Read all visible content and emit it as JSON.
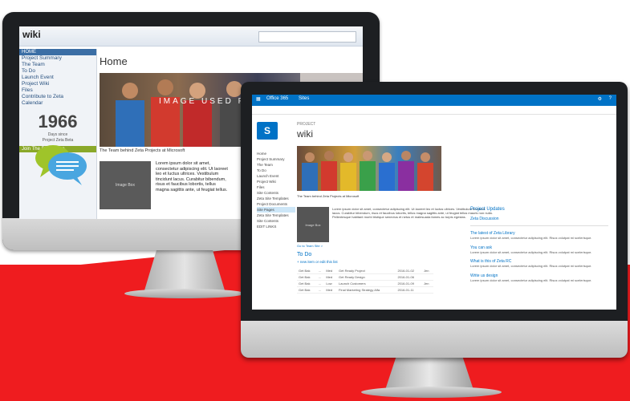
{
  "back_screen": {
    "logo": "wiki",
    "sidebar_header": "HOME",
    "sidebar_items": [
      "Project Summary",
      "The Team",
      "To Do",
      "Launch Event",
      "Project Wiki",
      "Files",
      "Contribute to Zeta",
      "Calendar"
    ],
    "big_number": "1966",
    "big_number_sub1": "Days since",
    "big_number_sub2": "Project Zeta Beta",
    "green_bar": "Join The Discussion",
    "page_title": "Home",
    "hero_overlay": "IMAGE USED FOR W",
    "caption": "The Team behind Zeta Projects at Microsoft",
    "image_placeholder": "Image Box",
    "body_text": "Lorem ipsum dolor sit amet, consectetur adipiscing elit. Ut laoreet leo et luctus ultrices. Vestibulum tincidunt lacus. Curabitur bibendum, risus et faucibus lobortis, tellus magna sagittis ante, ut feugiat tellus."
  },
  "front_screen": {
    "topbar_brand": "Office 365",
    "topbar_app": "Sites",
    "crumb": "PROJECT",
    "title": "wiki",
    "nav_items": [
      "Home",
      "Project Summary",
      "The Team",
      "To Do",
      "Launch Event",
      "Project Wiki",
      "Files",
      "Site Contents",
      "Zeta Site Templates",
      "Project Documents",
      "Site Pages",
      "Zeta Site Templates",
      "Site Contents",
      "EDIT LINKS"
    ],
    "caption": "The Team behind Zeta Projects at Microsoft",
    "image_placeholder": "Image Box",
    "body_text": "Lorem ipsum dolor sit amet, consectetur adipiscing elit. Ut laoreet leo et luctus ultrices. Vestibulum tincidunt lacus. Curabitur bibendum, risus et faucibus lobortis, tellus magna sagittis ante, ut feugiat tellus mauris non nulla. Pellentesque habitant morbi tristique senectus et netus et malesuada fames ac turpis egestas.",
    "link": "Go to Team Site >",
    "todo_heading": "To Do",
    "new_item": "+ new item or edit this list",
    "todo_rows": [
      [
        "Get Bak",
        "...",
        "Med",
        "Get Ready Project",
        "2016-01-02",
        "Jen"
      ],
      [
        "Get Bak",
        "...",
        "Med",
        "Get Ready Design",
        "2016-01-06",
        ""
      ],
      [
        "Get Bak",
        "...",
        "Low",
        "Launch Customers",
        "2016-01-09",
        "Jen"
      ],
      [
        "Get Bak",
        "...",
        "Med",
        "Final Marketing Strategy Alfa",
        "2016-01-11",
        ""
      ]
    ],
    "right_heading": "Project Updates",
    "right_sub": "Zeta Discussion",
    "right_items": [
      {
        "title": "The latest of Zeta Library",
        "text": "Lorem ipsum dolor sit amet, consectetur adipiscing elit. Risus volutpat mi scelerisque."
      },
      {
        "title": "You can ask",
        "text": "Lorem ipsum dolor sit amet, consectetur adipiscing elit. Risus volutpat mi scelerisque."
      },
      {
        "title": "What is this of Zeta RC",
        "text": "Lorem ipsum dolor sit amet, consectetur adipiscing elit. Risus volutpat mi scelerisque."
      },
      {
        "title": "Write us design",
        "text": "Lorem ipsum dolor sit amet, consectetur adipiscing elit. Risus volutpat mi scelerisque."
      }
    ]
  }
}
